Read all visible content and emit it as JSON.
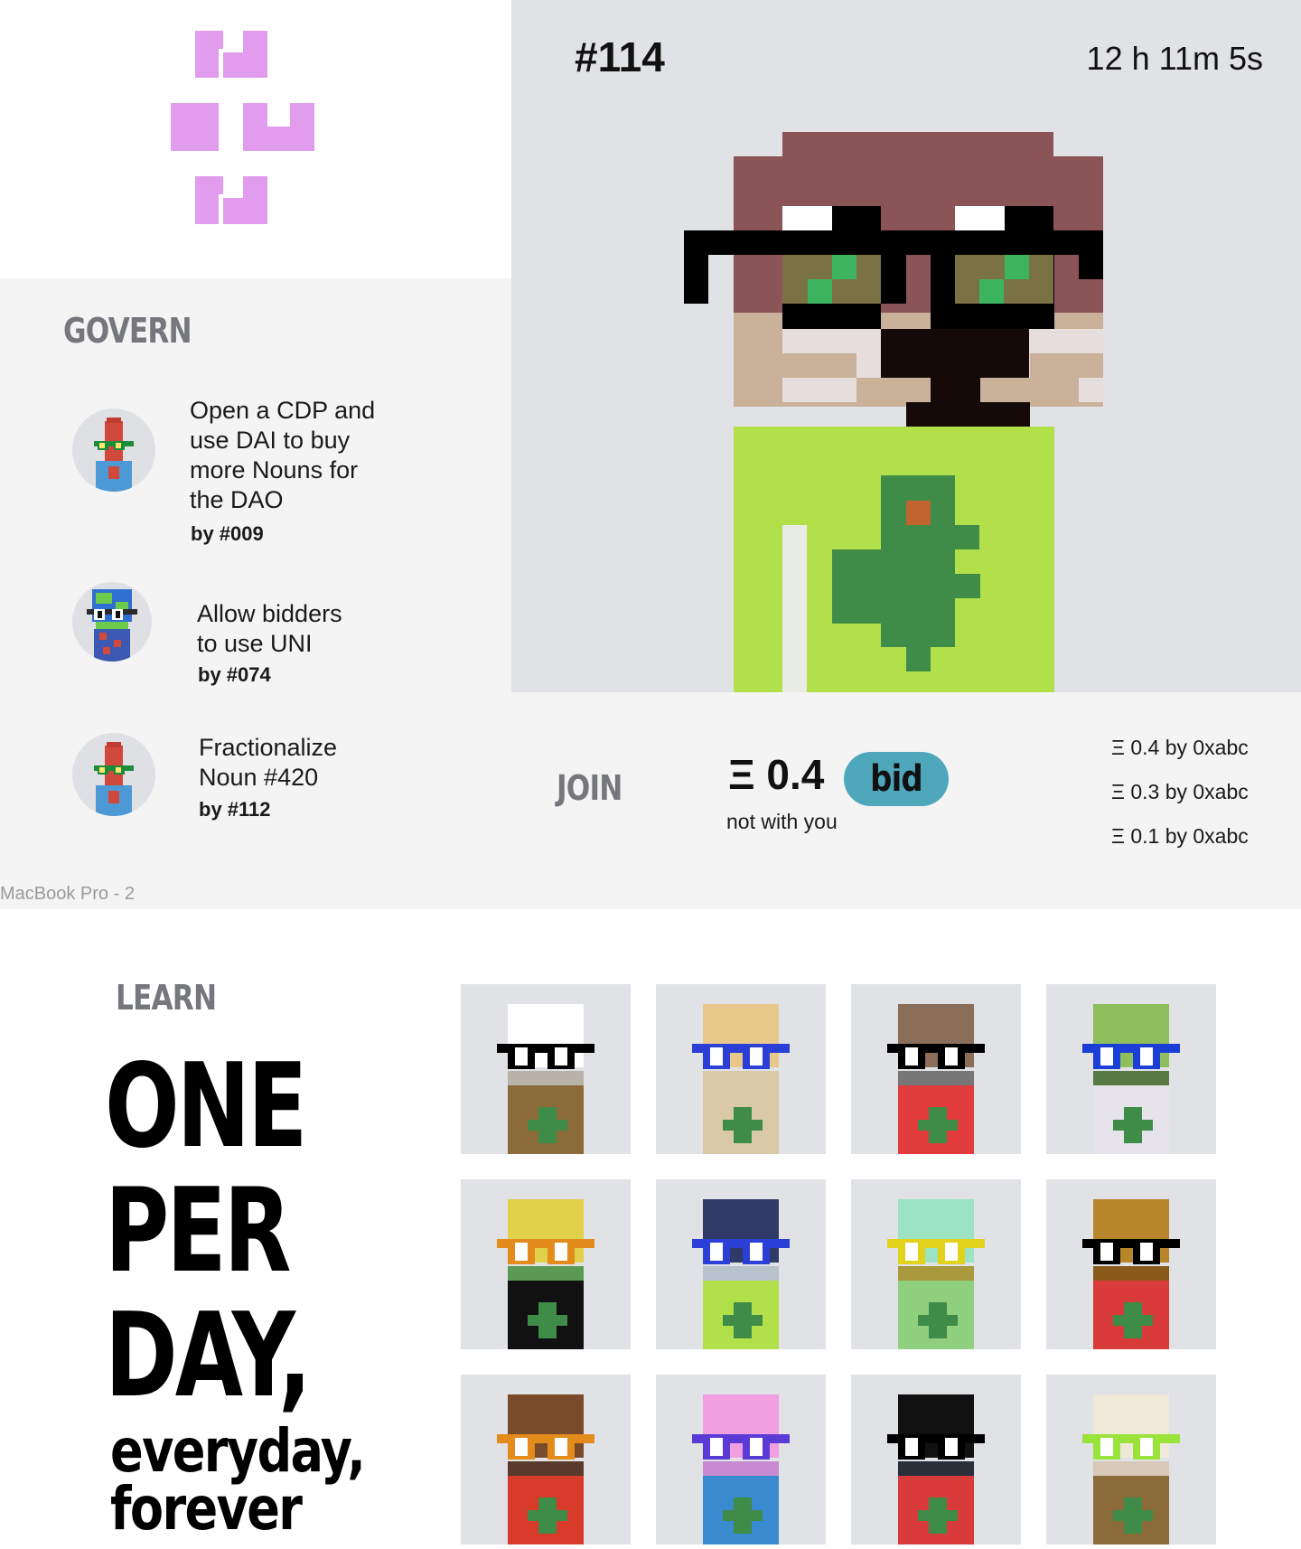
{
  "auction": {
    "noun_id": "#114",
    "countdown": "12 h 11m 5s"
  },
  "govern": {
    "heading": "GOVERN",
    "proposals": [
      {
        "title": "Open a CDP and use DAI to buy more Nouns for the DAO",
        "lines": [
          "Open a CDP and",
          "use DAI to buy",
          "more Nouns for",
          "the DAO"
        ],
        "by": "by #009"
      },
      {
        "title": "Allow bidders to use UNI",
        "lines": [
          "Allow bidders",
          "to use UNI"
        ],
        "by": "by #074"
      },
      {
        "title": "Fractionalize Noun #420",
        "lines": [
          "Fractionalize",
          "Noun #420"
        ],
        "by": "by #112"
      }
    ]
  },
  "frame_label": "MacBook Pro - 2",
  "join": {
    "heading": "JOIN",
    "current_bid": "Ξ 0.4",
    "bid_button": "bid",
    "status": "not with you",
    "bids": [
      "Ξ 0.4 by 0xabc",
      "Ξ 0.3 by 0xabc",
      "Ξ 0.1 by 0xabc"
    ]
  },
  "learn": {
    "heading": "LEARN",
    "headline_lines": [
      "ONE",
      "PER",
      "DAY,"
    ],
    "tagline_lines": [
      "everyday,",
      "forever"
    ]
  },
  "colors": {
    "logo_pink": "#e19ced",
    "hero_bg": "#e1e2e6",
    "bid_button": "#4fa7bb",
    "section_gray": "#75777d"
  },
  "gallery": {
    "rows": [
      [
        "noun-chef-shades",
        "noun-waffle-blue-glasses",
        "noun-goat-shades",
        "noun-plant-french-glasses"
      ],
      [
        "noun-pepper-orange-glasses",
        "noun-monitor-blue-glasses",
        "noun-ice-cream-yellow-glasses",
        "noun-lock-shades"
      ],
      [
        "noun-hat-orange-glasses",
        "noun-donut-purple-glasses",
        "noun-crow-shades",
        "noun-skull-green-glasses"
      ]
    ]
  }
}
